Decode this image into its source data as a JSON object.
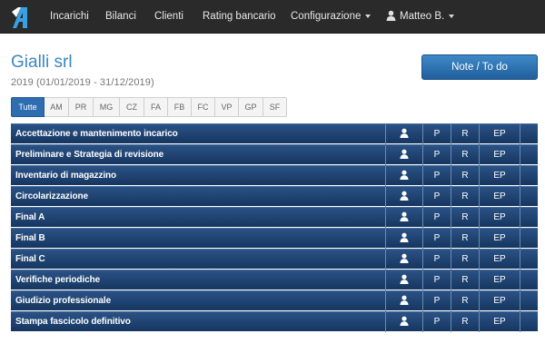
{
  "navbar": {
    "logo_text": "1A",
    "items": [
      {
        "label": "Incarichi"
      },
      {
        "label": "Bilanci"
      },
      {
        "label": "Clienti"
      },
      {
        "label": "Rating bancario"
      },
      {
        "label": "Configurazione"
      }
    ],
    "user_label": "Matteo B."
  },
  "header": {
    "company": "Gialli srl",
    "period": "2019 (01/01/2019 - 31/12/2019)",
    "notes_button": "Note / To do"
  },
  "tabs": [
    "Tutte",
    "AM",
    "PR",
    "MG",
    "CZ",
    "FA",
    "FB",
    "FC",
    "VP",
    "GP",
    "SF"
  ],
  "active_tab": "Tutte",
  "table": {
    "columns": {
      "p": "P",
      "r": "R",
      "ep": "EP"
    },
    "rows": [
      {
        "title": "Accettazione e mantenimento incarico"
      },
      {
        "title": "Preliminare e Strategia di revisione"
      },
      {
        "title": "Inventario di magazzino"
      },
      {
        "title": "Circolarizzazione"
      },
      {
        "title": "Final A"
      },
      {
        "title": "Final B"
      },
      {
        "title": "Final C"
      },
      {
        "title": "Verifiche periodiche"
      },
      {
        "title": "Giudizio professionale"
      },
      {
        "title": "Stampa fascicolo definitivo"
      }
    ]
  },
  "colors": {
    "navbar_bg": "#2a2a2a",
    "accent": "#3a87c2",
    "row_bg": "#1f4370",
    "tab_active": "#2d6db0"
  },
  "icons": {
    "logo": "app-logo",
    "user": "user-icon",
    "dropdown": "chevron-down-icon"
  }
}
